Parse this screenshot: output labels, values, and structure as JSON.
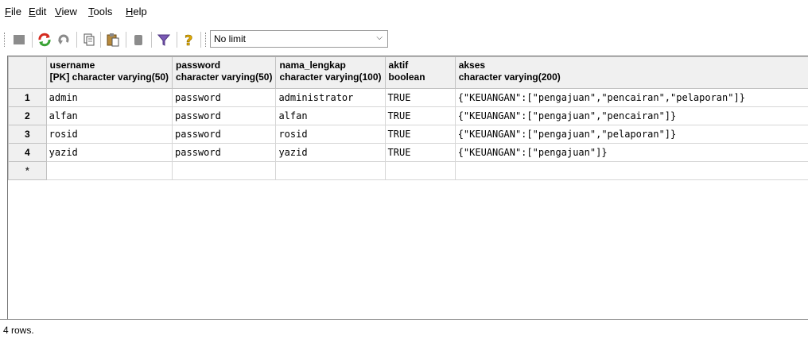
{
  "menu": {
    "file": {
      "pre": "",
      "u": "F",
      "post": "ile"
    },
    "edit": {
      "pre": "",
      "u": "E",
      "post": "dit"
    },
    "view": {
      "pre": "",
      "u": "V",
      "post": "iew"
    },
    "tools": {
      "pre": "",
      "u": "T",
      "post": "ools"
    },
    "help": {
      "pre": "",
      "u": "H",
      "post": "elp"
    }
  },
  "toolbar": {
    "icons": [
      "stop-icon",
      "refresh-icon",
      "undo-icon",
      "copy-icon",
      "paste-icon",
      "delete-icon",
      "filter-icon",
      "help-icon"
    ],
    "limit_value": "No limit",
    "limit_chevron": "⌵"
  },
  "grid": {
    "columns": [
      {
        "name": "username",
        "type": "[PK] character varying(50)"
      },
      {
        "name": "password",
        "type": "character varying(50)"
      },
      {
        "name": "nama_lengkap",
        "type": "character varying(100)"
      },
      {
        "name": "aktif",
        "type": "boolean"
      },
      {
        "name": "akses",
        "type": "character varying(200)"
      }
    ],
    "rows": [
      {
        "num": "1",
        "username": "admin",
        "password": "password",
        "nama_lengkap": "administrator",
        "aktif": "TRUE",
        "akses": "{\"KEUANGAN\":[\"pengajuan\",\"pencairan\",\"pelaporan\"]}"
      },
      {
        "num": "2",
        "username": "alfan",
        "password": "password",
        "nama_lengkap": "alfan",
        "aktif": "TRUE",
        "akses": "{\"KEUANGAN\":[\"pengajuan\",\"pencairan\"]}"
      },
      {
        "num": "3",
        "username": "rosid",
        "password": "password",
        "nama_lengkap": "rosid",
        "aktif": "TRUE",
        "akses": "{\"KEUANGAN\":[\"pengajuan\",\"pelaporan\"]}"
      },
      {
        "num": "4",
        "username": "yazid",
        "password": "password",
        "nama_lengkap": "yazid",
        "aktif": "TRUE",
        "akses": "{\"KEUANGAN\":[\"pengajuan\"]}"
      }
    ],
    "new_row_marker": "*"
  },
  "status": {
    "text": "4 rows."
  },
  "colors": {
    "header_bg": "#f0f0f0",
    "grid_line": "#d6d6d6"
  }
}
